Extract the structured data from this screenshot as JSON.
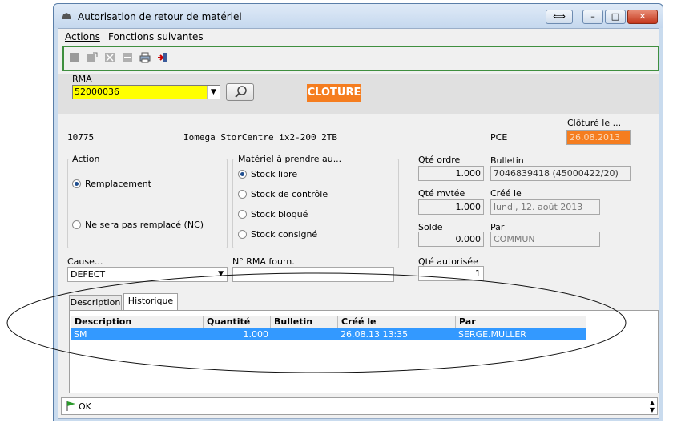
{
  "window": {
    "title": "Autorisation de retour de matériel",
    "controls": {
      "swap": "⟺",
      "minimize": "–",
      "maximize": "□",
      "close": "✕"
    }
  },
  "menu": {
    "actions": "Actions",
    "next_functions": "Fonctions suivantes"
  },
  "toolbar": {
    "icons": [
      "save-icon",
      "edit-icon",
      "delete-icon",
      "minus-icon",
      "print-icon",
      "exit-icon"
    ]
  },
  "header": {
    "rma_label": "RMA",
    "rma_value": "52000036",
    "status": "CLOTURE"
  },
  "item": {
    "code": "10775",
    "description": "Iomega StorCentre ix2-200 2TB",
    "unit": "PCE",
    "closed_label": "Clôturé le ...",
    "closed_date": "26.08.2013"
  },
  "action_group": {
    "title": "Action",
    "options": [
      {
        "label": "Remplacement",
        "selected": true
      },
      {
        "label": "Ne sera pas remplacé (NC)",
        "selected": false
      }
    ]
  },
  "material_group": {
    "title": "Matériel à prendre au...",
    "options": [
      {
        "label": "Stock libre",
        "selected": true
      },
      {
        "label": "Stock de contrôle",
        "selected": false
      },
      {
        "label": "Stock bloqué",
        "selected": false
      },
      {
        "label": "Stock consigné",
        "selected": false
      }
    ]
  },
  "quantities": {
    "order_label": "Qté ordre",
    "order_value": "1.000",
    "moved_label": "Qté mvtée",
    "moved_value": "1.000",
    "balance_label": "Solde",
    "balance_value": "0.000",
    "authorized_label": "Qté autorisée",
    "authorized_value": "1"
  },
  "info": {
    "bulletin_label": "Bulletin",
    "bulletin_value": "7046839418 (45000422/20)",
    "created_label": "Créé le",
    "created_value": "lundi, 12. août 2013",
    "by_label": "Par",
    "by_value": "COMMUN"
  },
  "cause": {
    "label": "Cause...",
    "value": "DEFECT"
  },
  "supplier_rma": {
    "label": "N° RMA fourn.",
    "value": ""
  },
  "tabs": [
    {
      "label": "Description",
      "active": false
    },
    {
      "label": "Historique",
      "active": true
    }
  ],
  "history": {
    "columns": [
      "Description",
      "Quantité",
      "Bulletin",
      "Créé le",
      "Par"
    ],
    "rows": [
      [
        "SM",
        "1.000",
        "",
        "26.08.13 13:35",
        "SERGE.MULLER"
      ]
    ]
  },
  "statusbar": {
    "text": "OK"
  },
  "colors": {
    "accent": "#f57d1f",
    "highlight": "#3399ff",
    "rma_bg": "#ffff00",
    "toolbar_border": "#3f8f3f"
  }
}
